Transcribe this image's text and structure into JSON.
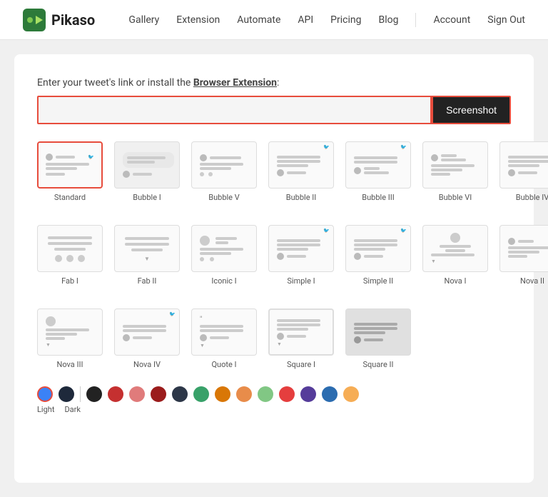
{
  "header": {
    "logo_text": "Pikaso",
    "nav_items": [
      "Gallery",
      "Extension",
      "Automate",
      "API",
      "Pricing",
      "Blog",
      "Account",
      "Sign Out"
    ]
  },
  "url_section": {
    "label_prefix": "Enter your tweet's link or install the ",
    "label_link": "Browser Extension",
    "label_suffix": ":",
    "input_placeholder": "",
    "screenshot_btn": "Screenshot"
  },
  "templates": {
    "row1": [
      {
        "id": "standard",
        "label": "Standard",
        "selected": true
      },
      {
        "id": "bubble1",
        "label": "Bubble I"
      },
      {
        "id": "bubblev",
        "label": "Bubble V"
      },
      {
        "id": "bubble2",
        "label": "Bubble II"
      },
      {
        "id": "bubble3",
        "label": "Bubble III"
      },
      {
        "id": "bubble6",
        "label": "Bubble VI"
      },
      {
        "id": "bubble4",
        "label": "Bubble IV"
      }
    ],
    "row2": [
      {
        "id": "fab1",
        "label": "Fab I"
      },
      {
        "id": "fab2",
        "label": "Fab II"
      },
      {
        "id": "iconic1",
        "label": "Iconic I"
      },
      {
        "id": "simple1",
        "label": "Simple I"
      },
      {
        "id": "simple2",
        "label": "Simple II"
      },
      {
        "id": "nova1",
        "label": "Nova I"
      },
      {
        "id": "nova2",
        "label": "Nova II"
      }
    ],
    "row3": [
      {
        "id": "nova3",
        "label": "Nova III"
      },
      {
        "id": "nova4",
        "label": "Nova IV"
      },
      {
        "id": "quote1",
        "label": "Quote I"
      },
      {
        "id": "square1",
        "label": "Square I"
      },
      {
        "id": "square2",
        "label": "Square II"
      }
    ]
  },
  "colors": {
    "light_label": "Light",
    "dark_label": "Dark",
    "light_swatch": "#3b82f6",
    "dark_swatch": "#1e293b",
    "palette": [
      {
        "color": "#222222",
        "selected": false
      },
      {
        "color": "#e53e3e",
        "selected": false
      },
      {
        "color": "#e07b7b",
        "selected": false
      },
      {
        "color": "#c53030",
        "selected": false
      },
      {
        "color": "#2d3748",
        "selected": false
      },
      {
        "color": "#38a169",
        "selected": false
      },
      {
        "color": "#d97706",
        "selected": false
      },
      {
        "color": "#e88c4a",
        "selected": false
      },
      {
        "color": "#81c784",
        "selected": false
      },
      {
        "color": "#e53e3e",
        "selected": false
      },
      {
        "color": "#553c9a",
        "selected": false
      },
      {
        "color": "#2b6cb0",
        "selected": false
      },
      {
        "color": "#f6ad55",
        "selected": false
      }
    ]
  }
}
